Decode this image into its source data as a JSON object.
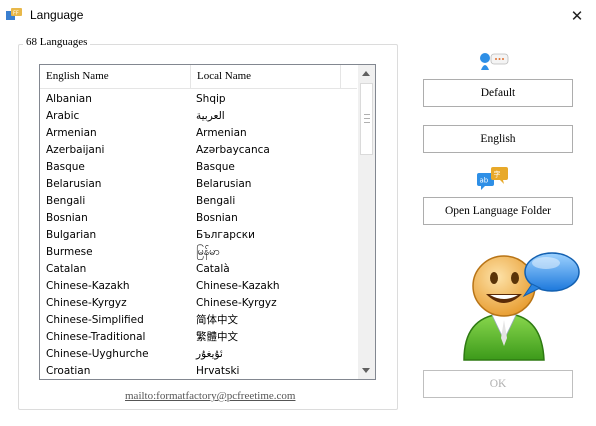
{
  "window": {
    "title": "Language",
    "close_glyph": "✕"
  },
  "group": {
    "label": "68 Languages"
  },
  "list": {
    "headers": [
      "English Name",
      "Local Name"
    ],
    "rows": [
      {
        "en": "Albanian",
        "local": "Shqip"
      },
      {
        "en": "Arabic",
        "local": "العربية"
      },
      {
        "en": "Armenian",
        "local": "Armenian"
      },
      {
        "en": "Azerbaijani",
        "local": "Azərbaycanca"
      },
      {
        "en": "Basque",
        "local": "Basque"
      },
      {
        "en": "Belarusian",
        "local": "Belarusian"
      },
      {
        "en": "Bengali",
        "local": "Bengali"
      },
      {
        "en": "Bosnian",
        "local": "Bosnian"
      },
      {
        "en": "Bulgarian",
        "local": "Български"
      },
      {
        "en": "Burmese",
        "local": "မြန်မာ"
      },
      {
        "en": "Catalan",
        "local": "Català"
      },
      {
        "en": "Chinese-Kazakh",
        "local": "Chinese-Kazakh"
      },
      {
        "en": "Chinese-Kyrgyz",
        "local": "Chinese-Kyrgyz"
      },
      {
        "en": "Chinese-Simplified",
        "local": "简体中文"
      },
      {
        "en": "Chinese-Traditional",
        "local": "繁體中文"
      },
      {
        "en": "Chinese-Uyghurche",
        "local": "ئۇيغۇر"
      },
      {
        "en": "Croatian",
        "local": "Hrvatski"
      }
    ]
  },
  "mailto": "mailto:formatfactory@pcfreetime.com",
  "buttons": {
    "default": "Default",
    "english": "English",
    "open_folder": "Open Language Folder",
    "ok": "OK"
  },
  "icons": {
    "app": "format-factory-app-icon",
    "speech": "speech-person-icon",
    "translate": "translate-bubbles-icon",
    "user": "user-speech-icon"
  },
  "colors": {
    "user_green": "#5ab52c",
    "bubble_blue": "#2e8fe6",
    "face": "#f5b450"
  }
}
